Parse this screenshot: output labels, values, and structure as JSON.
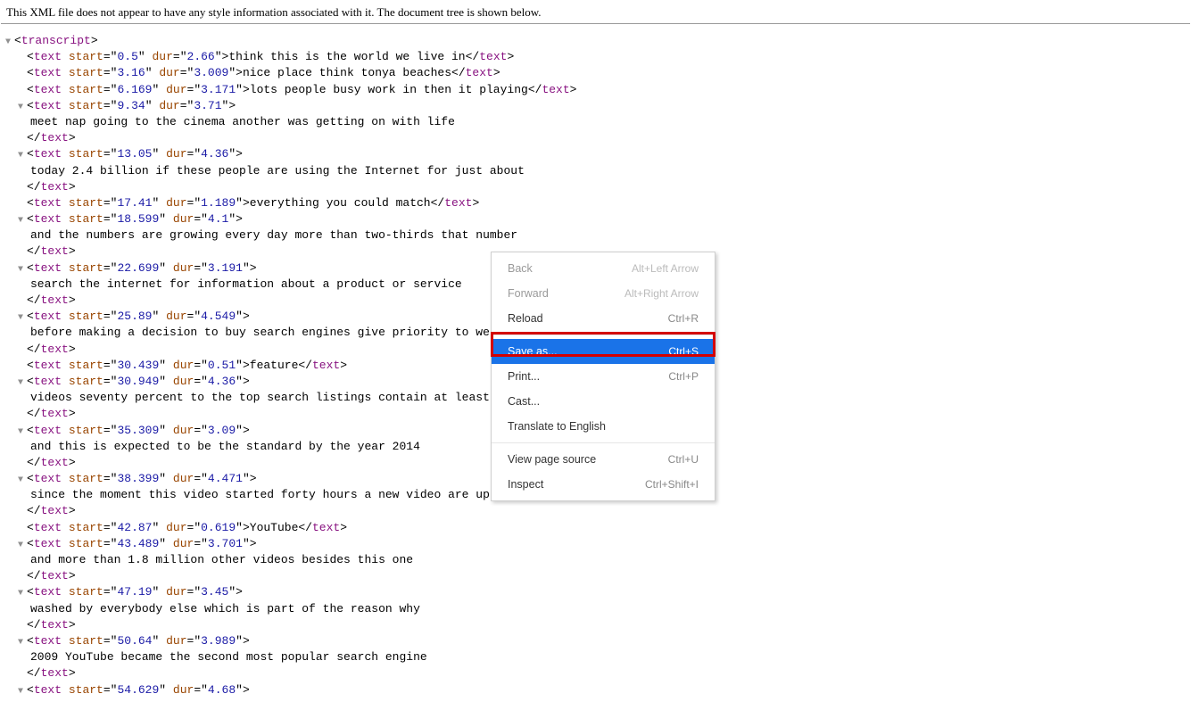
{
  "notice": "This XML file does not appear to have any style information associated with it. The document tree is shown below.",
  "root_tag": "transcript",
  "entries": [
    {
      "start": "0.5",
      "dur": "2.66",
      "text": "think this is the world we live in",
      "multi": false,
      "arrow": false
    },
    {
      "start": "3.16",
      "dur": "3.009",
      "text": "nice place think tonya beaches",
      "multi": false,
      "arrow": false
    },
    {
      "start": "6.169",
      "dur": "3.171",
      "text": "lots people busy work in then it playing",
      "multi": false,
      "arrow": false
    },
    {
      "start": "9.34",
      "dur": "3.71",
      "text": "meet nap going to the cinema another was getting on with life",
      "multi": true,
      "arrow": true
    },
    {
      "start": "13.05",
      "dur": "4.36",
      "text": "today 2.4 billion if these people are using the Internet for just about",
      "multi": true,
      "arrow": true
    },
    {
      "start": "17.41",
      "dur": "1.189",
      "text": "everything you could match",
      "multi": false,
      "arrow": false
    },
    {
      "start": "18.599",
      "dur": "4.1",
      "text": "and the numbers are growing every day more than two-thirds that number",
      "multi": true,
      "arrow": true
    },
    {
      "start": "22.699",
      "dur": "3.191",
      "text": "search the internet for information about a product or service",
      "multi": true,
      "arrow": true
    },
    {
      "start": "25.89",
      "dur": "4.549",
      "text": "before making a decision to buy search engines give priority to web sites that",
      "multi": true,
      "arrow": true
    },
    {
      "start": "30.439",
      "dur": "0.51",
      "text": "feature",
      "multi": false,
      "arrow": false
    },
    {
      "start": "30.949",
      "dur": "4.36",
      "text": "videos seventy percent to the top search listings contain at least one video",
      "multi": true,
      "arrow": true
    },
    {
      "start": "35.309",
      "dur": "3.09",
      "text": "and this is expected to be the standard by the year 2014",
      "multi": true,
      "arrow": true
    },
    {
      "start": "38.399",
      "dur": "4.471",
      "text": "since the moment this video started forty hours a new video are uploaded to",
      "multi": true,
      "arrow": true
    },
    {
      "start": "42.87",
      "dur": "0.619",
      "text": "YouTube",
      "multi": false,
      "arrow": false
    },
    {
      "start": "43.489",
      "dur": "3.701",
      "text": "and more than 1.8 million other videos besides this one",
      "multi": true,
      "arrow": true
    },
    {
      "start": "47.19",
      "dur": "3.45",
      "text": "washed by everybody else which is part of the reason why",
      "multi": true,
      "arrow": true
    },
    {
      "start": "50.64",
      "dur": "3.989",
      "text": "2009 YouTube became the second most popular search engine",
      "multi": true,
      "arrow": true
    },
    {
      "start": "54.629",
      "dur": "4.68",
      "text": "",
      "multi": true,
      "arrow": true,
      "open_only": true
    }
  ],
  "context_menu": {
    "items": [
      {
        "label": "Back",
        "shortcut": "Alt+Left Arrow",
        "disabled": true
      },
      {
        "label": "Forward",
        "shortcut": "Alt+Right Arrow",
        "disabled": true
      },
      {
        "label": "Reload",
        "shortcut": "Ctrl+R",
        "disabled": false
      },
      {
        "sep": true
      },
      {
        "label": "Save as...",
        "shortcut": "Ctrl+S",
        "disabled": false,
        "highlighted": true
      },
      {
        "label": "Print...",
        "shortcut": "Ctrl+P",
        "disabled": false
      },
      {
        "label": "Cast...",
        "shortcut": "",
        "disabled": false
      },
      {
        "label": "Translate to English",
        "shortcut": "",
        "disabled": false
      },
      {
        "sep": true
      },
      {
        "label": "View page source",
        "shortcut": "Ctrl+U",
        "disabled": false
      },
      {
        "label": "Inspect",
        "shortcut": "Ctrl+Shift+I",
        "disabled": false
      }
    ]
  }
}
